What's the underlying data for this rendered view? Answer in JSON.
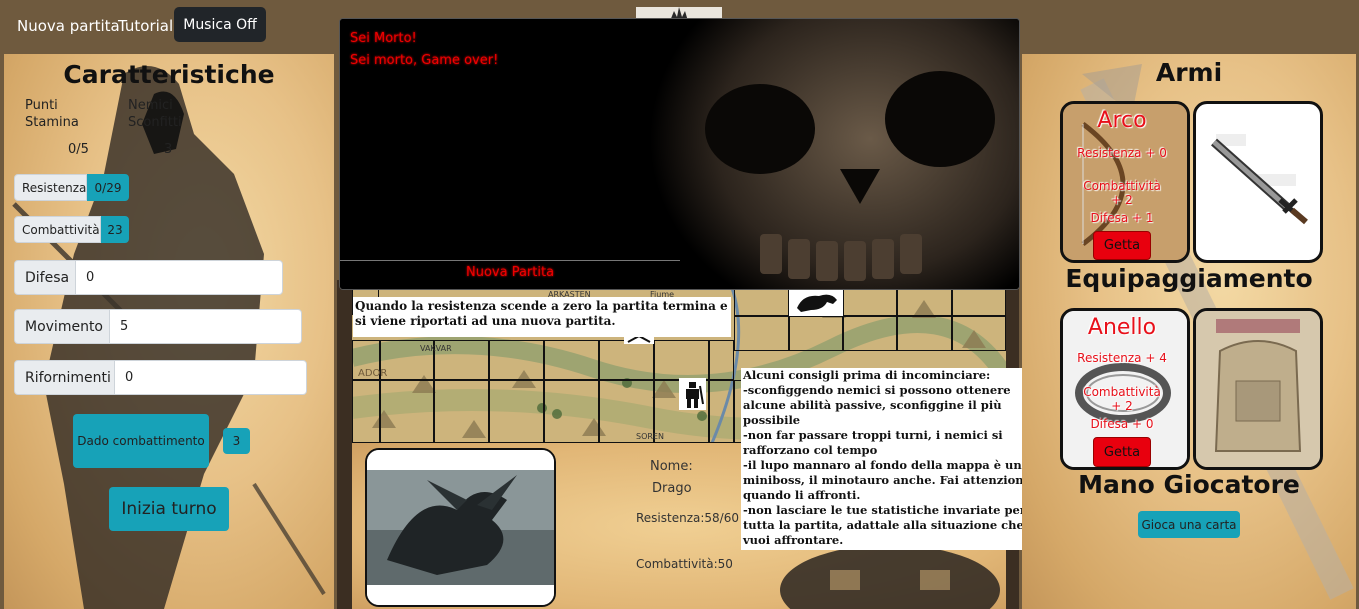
{
  "nav": {
    "new_game": "Nuova partita",
    "tutorial": "Tutorial",
    "music": "Musica Off"
  },
  "left": {
    "title": "Caratteristiche",
    "stamina_label_1": "Punti",
    "stamina_label_2": "Stamina",
    "enemies_label_1": "Nemici",
    "enemies_label_2": "Sconfitti",
    "stamina_value": "0/5",
    "enemies_value": "3",
    "resistenza_label": "Resistenza",
    "resistenza_value": "0/29",
    "combattivita_label": "Combattività",
    "combattivita_value": "23",
    "difesa_label": "Difesa",
    "difesa_value": "0",
    "movimento_label": "Movimento",
    "movimento_value": "5",
    "rifornimenti_label": "Rifornimenti",
    "rifornimenti_value": "0",
    "dice_label": "Dado combattimento",
    "dice_value": "3",
    "start_turn": "Inizia turno"
  },
  "modal": {
    "line1": "Sei Morto!",
    "line2": "Sei morto, Game over!",
    "button": "Nuova Partita"
  },
  "map": {
    "labels": [
      "ARKASTEN",
      "Fiume",
      "VAKVAR",
      "ADOR",
      "SOREN"
    ]
  },
  "tip_top": "Quando la resistenza scende a zero la partita termina e si viene riportati ad una nuova partita.",
  "tips": {
    "heading": "Alcuni consigli prima di incominciare:",
    "lines": [
      "-sconfiggendo nemici si possono ottenere alcune abilità passive, sconfiggine il più possibile",
      "-non far passare troppi turni, i nemici si rafforzano col tempo",
      "-il lupo mannaro al fondo della mappa è un miniboss, il minotauro anche. Fai attenzione quando li affronti.",
      "-non lasciare le tue statistiche invariate per tutta la partita, adattale alla situazione che vuoi affrontare."
    ]
  },
  "enemy": {
    "name_label": "Nome:",
    "name": "Drago",
    "resistenza": "Resistenza:58/60",
    "combattivita": "Combattività:50"
  },
  "right": {
    "weapons_title": "Armi",
    "equipment_title": "Equipaggiamento",
    "hand_title": "Mano Giocatore",
    "play_card": "Gioca una carta",
    "weapon_card": {
      "name": "Arco",
      "res": "Resistenza + 0",
      "comb_1": "Combattività",
      "comb_2": "+ 2",
      "dif": "Difesa + 1",
      "discard": "Getta"
    },
    "equip_card": {
      "name": "Anello",
      "res": "Resistenza + 4",
      "comb_1": "Combattività",
      "comb_2": "+ 2",
      "dif": "Difesa + 0",
      "discard": "Getta"
    }
  },
  "colors": {
    "accent": "#17a2b8",
    "danger": "#e8000e",
    "nav_bg": "#6f5a3e"
  }
}
